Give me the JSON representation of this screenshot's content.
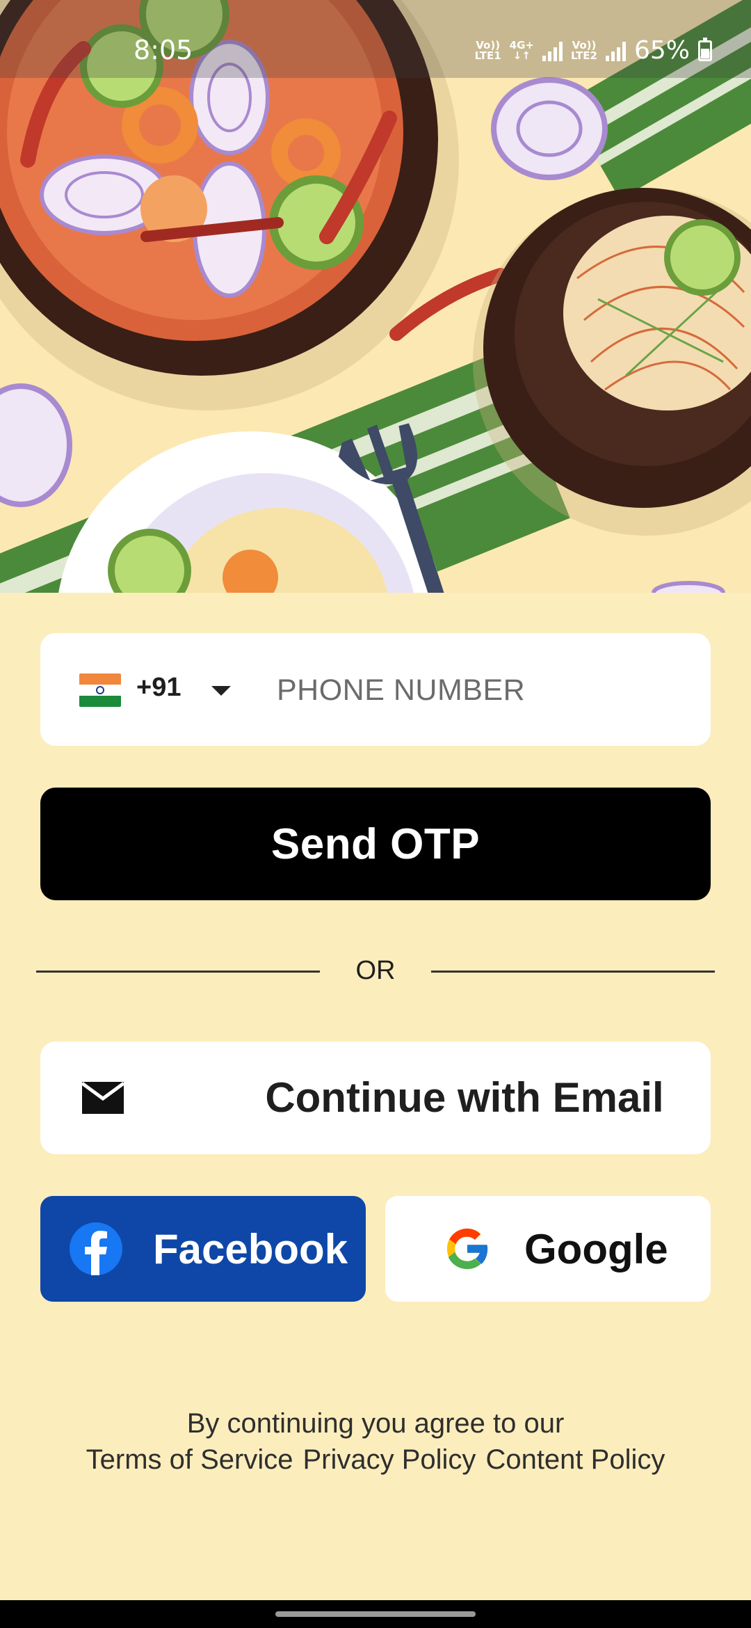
{
  "status_bar": {
    "time": "8:05",
    "sim1_label_top": "Vo))",
    "sim1_label_bottom": "LTE1",
    "network_top": "4G+",
    "network_bottom": "↓↑",
    "sim2_label_top": "Vo))",
    "sim2_label_bottom": "LTE2",
    "battery": "65%"
  },
  "phone": {
    "country_code": "+91",
    "placeholder": "PHONE NUMBER",
    "flag_icon": "india-flag-icon"
  },
  "otp_button": {
    "label": "Send OTP"
  },
  "divider": {
    "label": "OR"
  },
  "email_button": {
    "label": "Continue with Email",
    "icon": "mail-icon"
  },
  "facebook_button": {
    "label": "Facebook",
    "icon": "facebook-icon",
    "color": "#0e47a8"
  },
  "google_button": {
    "label": "Google",
    "icon": "google-icon"
  },
  "terms": {
    "intro": "By continuing you agree to our",
    "terms_of_service": "Terms of Service",
    "privacy_policy": "Privacy Policy",
    "content_policy": "Content Policy"
  },
  "colors": {
    "background": "#fcedbd",
    "primary_button": "#000000",
    "facebook": "#0e47a8"
  }
}
